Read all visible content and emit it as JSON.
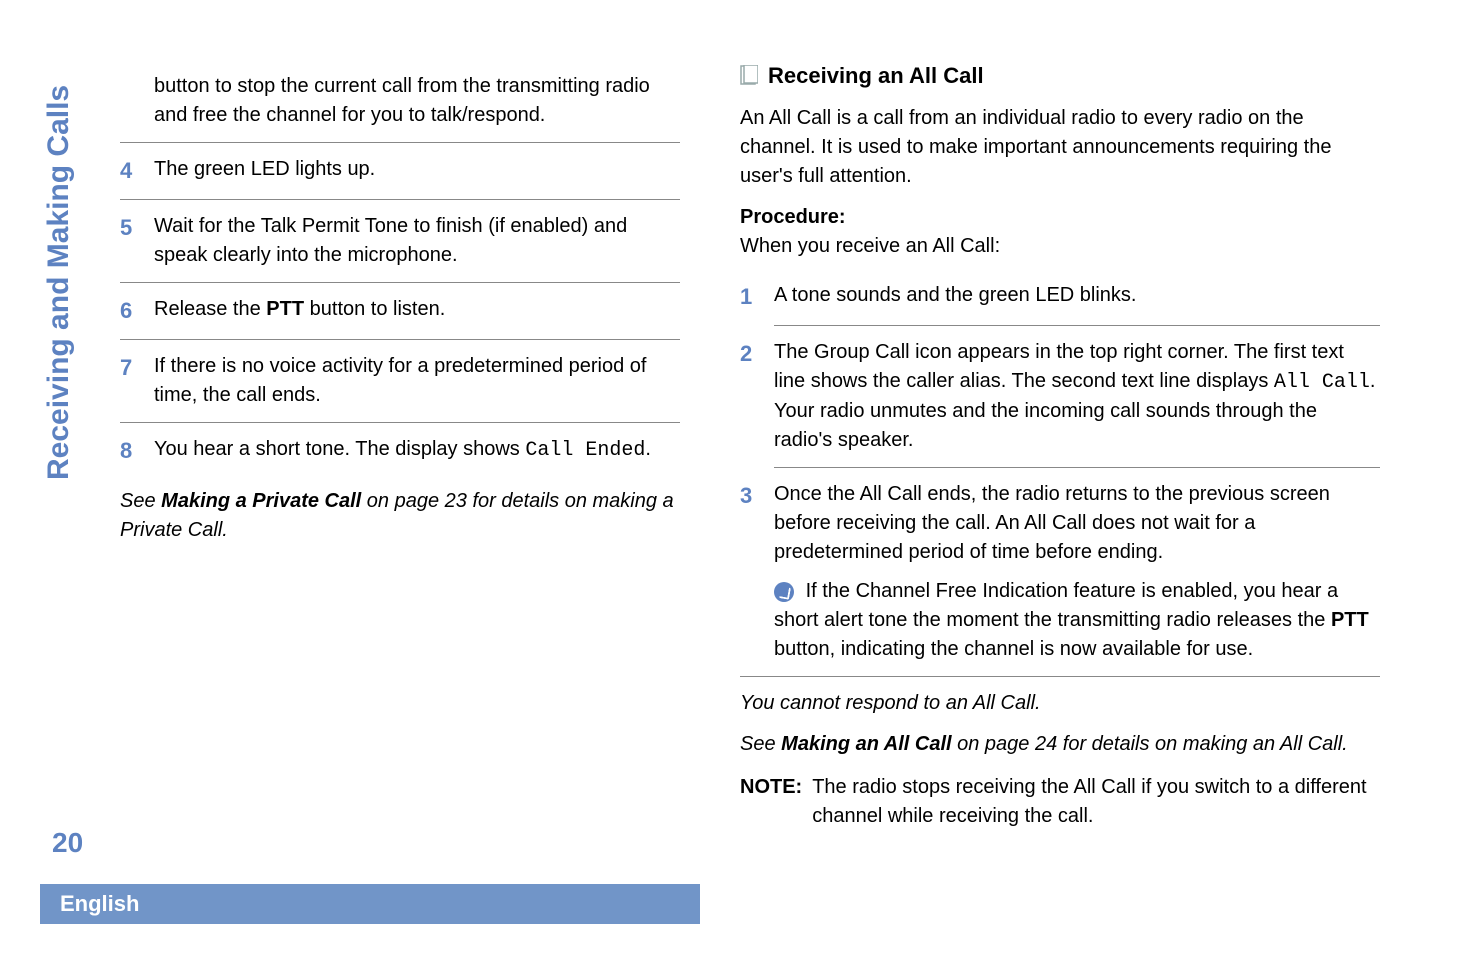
{
  "sidebar": {
    "text": "Receiving and Making Calls"
  },
  "page_number": "20",
  "footer": {
    "language": "English"
  },
  "left": {
    "pre_step_text": "button to stop the current call from the transmitting radio and free the channel for you to talk/respond.",
    "steps": {
      "4": "The green LED lights up.",
      "5": "Wait for the Talk Permit Tone to finish (if enabled) and speak clearly into the microphone.",
      "6_pre": "Release the ",
      "6_bold": "PTT",
      "6_post": " button to listen.",
      "7": "If there is no voice activity for a predetermined period of time, the call ends.",
      "8_pre": "You hear a short tone. The display shows ",
      "8_mono": "Call Ended",
      "8_post": "."
    },
    "see_pre": "See ",
    "see_bold": "Making a Private Call",
    "see_post": " on page 23 for details on making a Private Call."
  },
  "right": {
    "heading": "Receiving an All Call",
    "intro": "An All Call is a call from an individual radio to every radio on the channel. It is used to make important announcements requiring the user's full attention.",
    "procedure_label": "Procedure:",
    "procedure_sub": "When you receive an All Call:",
    "steps": {
      "1": "A tone sounds and the green LED blinks.",
      "2_a": "The Group Call icon appears in the top right corner. The first text line shows the caller alias. The second text line displays ",
      "2_mono": "All Call",
      "2_b": ". Your radio unmutes and the incoming call sounds through the radio's speaker.",
      "3_a": "Once the All Call ends, the radio returns to the previous screen before receiving the call. An All Call does not wait for a predetermined period of time before ending.",
      "3_note_pre": "If the Channel Free Indication feature is enabled, you hear a short alert tone the moment the transmitting radio releases the ",
      "3_note_bold": "PTT",
      "3_note_post": " button, indicating the channel is now available for use."
    },
    "cannot": "You cannot respond to an All Call.",
    "see_pre": "See ",
    "see_bold": "Making an All Call",
    "see_post": " on page 24 for details on making an All Call.",
    "note_label": "NOTE:",
    "note_body": "The radio stops receiving the All Call if you switch to a different channel while receiving the call."
  }
}
